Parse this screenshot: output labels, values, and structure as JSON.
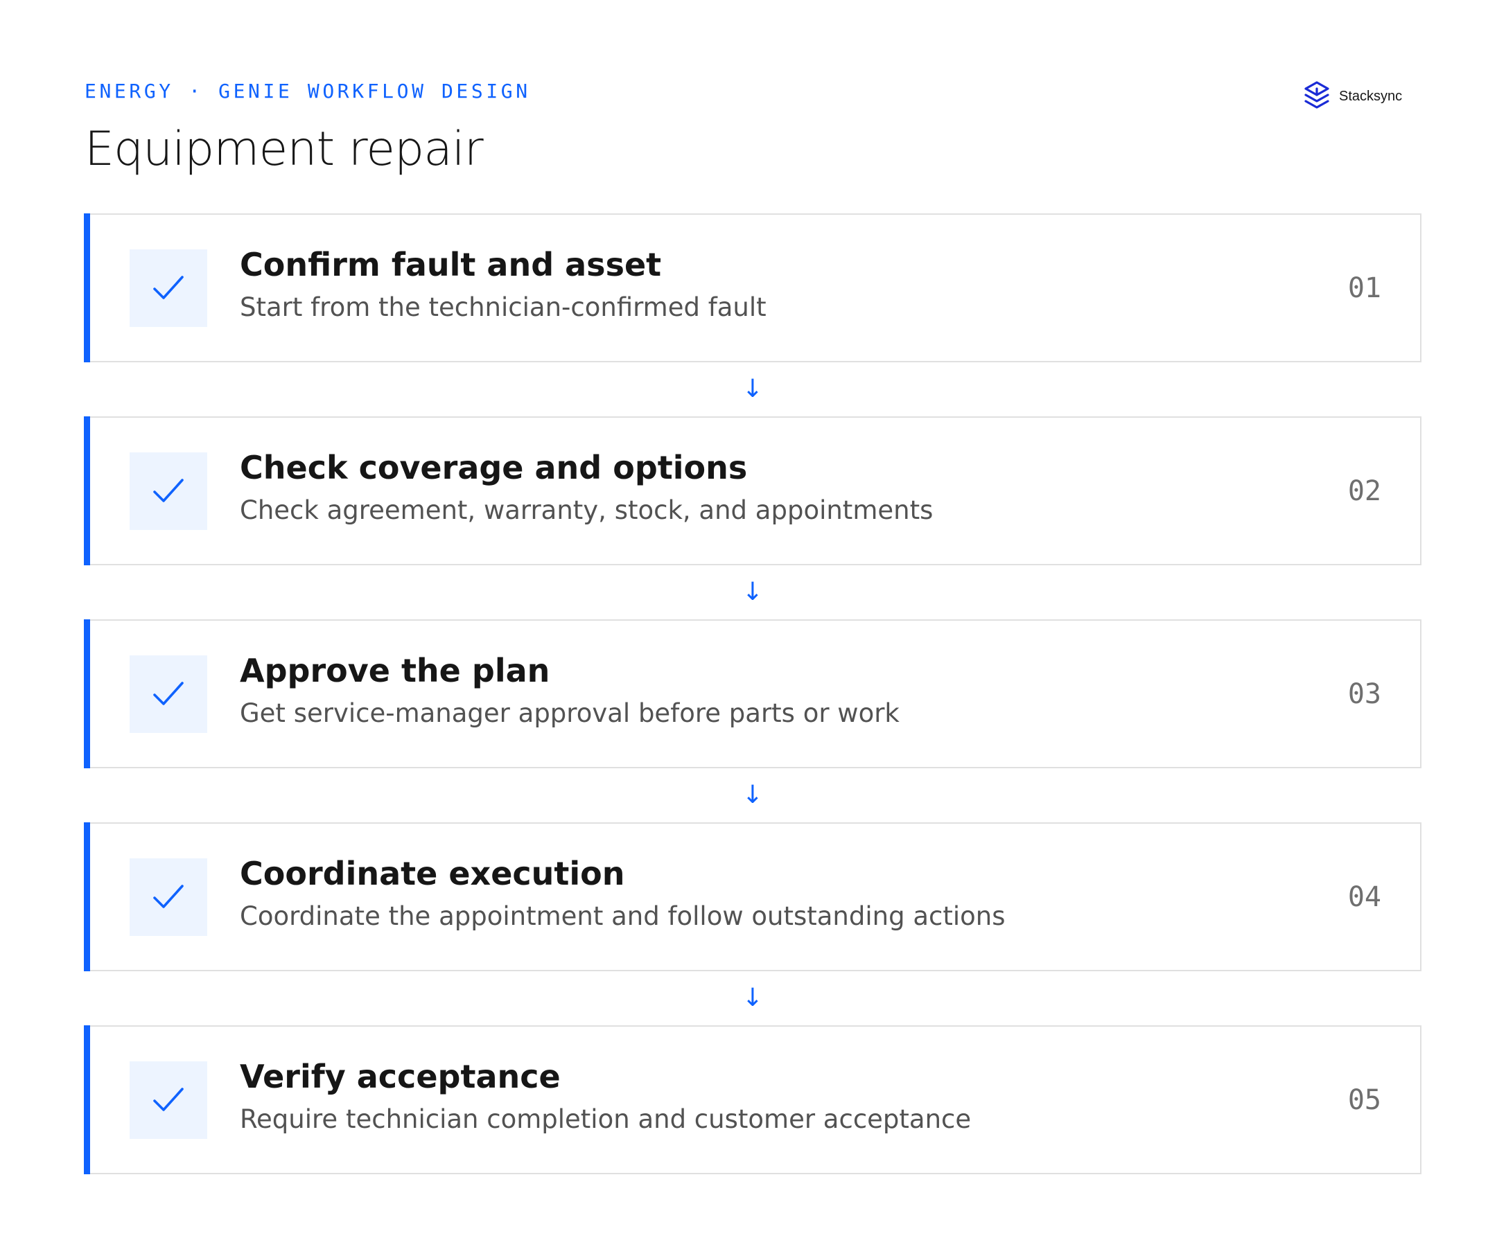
{
  "header": {
    "eyebrow": "ENERGY · GENIE WORKFLOW DESIGN",
    "title": "Equipment repair"
  },
  "brand": {
    "name": "Stacksync",
    "icon": "stacksync-logo-icon",
    "color": "#1a2bd6"
  },
  "colors": {
    "accent": "#0f62fe",
    "check_bg": "#edf4ff",
    "border": "#e0e0e0"
  },
  "connector_glyph": "↓",
  "steps": [
    {
      "title": "Confirm fault and asset",
      "description": "Start from the technician-confirmed fault",
      "number": "01",
      "icon": "checkmark-icon"
    },
    {
      "title": "Check coverage and options",
      "description": "Check agreement, warranty, stock, and appointments",
      "number": "02",
      "icon": "checkmark-icon"
    },
    {
      "title": "Approve the plan",
      "description": "Get service-manager approval before parts or work",
      "number": "03",
      "icon": "checkmark-icon"
    },
    {
      "title": "Coordinate execution",
      "description": "Coordinate the appointment and follow outstanding actions",
      "number": "04",
      "icon": "checkmark-icon"
    },
    {
      "title": "Verify acceptance",
      "description": "Require technician completion and customer acceptance",
      "number": "05",
      "icon": "checkmark-icon"
    }
  ]
}
